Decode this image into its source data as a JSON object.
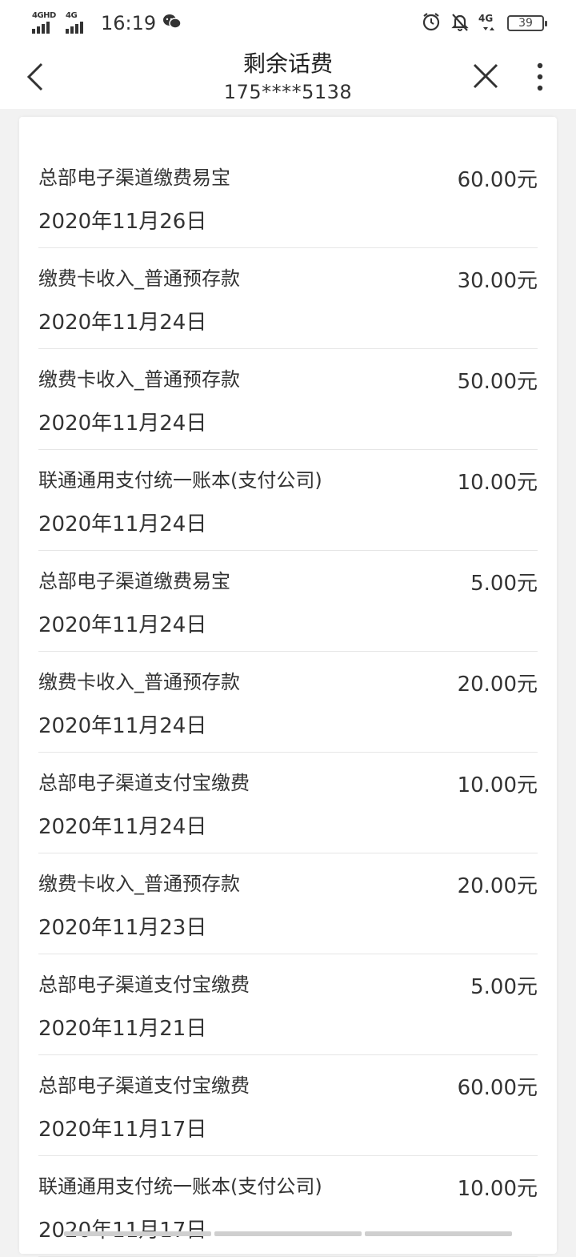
{
  "status_bar": {
    "signal1_label": "4GHD",
    "signal2_label": "4G",
    "time": "16:19",
    "network_right": "4G",
    "battery": "39"
  },
  "nav": {
    "title": "剩余话费",
    "subtitle": "175****5138"
  },
  "records": [
    {
      "name": "总部电子渠道缴费易宝",
      "date": "2020年11月26日",
      "amount": "60.00元"
    },
    {
      "name": "缴费卡收入_普通预存款",
      "date": "2020年11月24日",
      "amount": "30.00元"
    },
    {
      "name": "缴费卡收入_普通预存款",
      "date": "2020年11月24日",
      "amount": "50.00元"
    },
    {
      "name": "联通通用支付统一账本(支付公司)",
      "date": "2020年11月24日",
      "amount": "10.00元"
    },
    {
      "name": "总部电子渠道缴费易宝",
      "date": "2020年11月24日",
      "amount": "5.00元"
    },
    {
      "name": "缴费卡收入_普通预存款",
      "date": "2020年11月24日",
      "amount": "20.00元"
    },
    {
      "name": "总部电子渠道支付宝缴费",
      "date": "2020年11月24日",
      "amount": "10.00元"
    },
    {
      "name": "缴费卡收入_普通预存款",
      "date": "2020年11月23日",
      "amount": "20.00元"
    },
    {
      "name": "总部电子渠道支付宝缴费",
      "date": "2020年11月21日",
      "amount": "5.00元"
    },
    {
      "name": "总部电子渠道支付宝缴费",
      "date": "2020年11月17日",
      "amount": "60.00元"
    },
    {
      "name": "联通通用支付统一账本(支付公司)",
      "date": "2020年11月17日",
      "amount": "10.00元"
    }
  ]
}
